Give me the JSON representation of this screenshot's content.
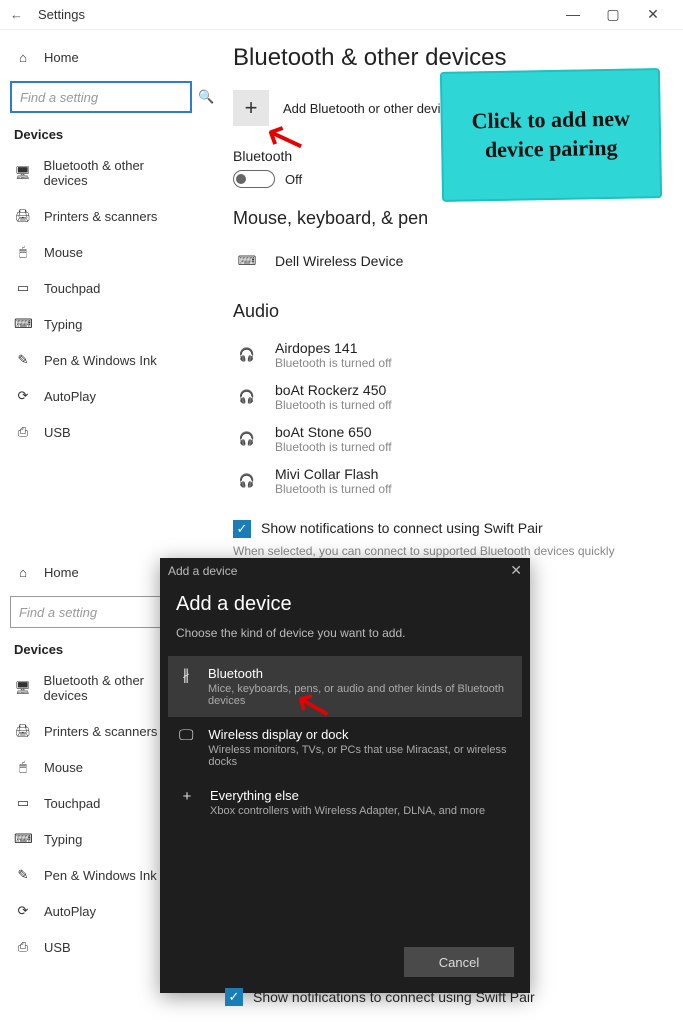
{
  "window": {
    "title": "Settings"
  },
  "nav": {
    "home": "Home",
    "search_placeholder": "Find a setting",
    "section": "Devices",
    "items": [
      {
        "label": "Bluetooth & other devices"
      },
      {
        "label": "Printers & scanners"
      },
      {
        "label": "Mouse"
      },
      {
        "label": "Touchpad"
      },
      {
        "label": "Typing"
      },
      {
        "label": "Pen & Windows Ink"
      },
      {
        "label": "AutoPlay"
      },
      {
        "label": "USB"
      }
    ]
  },
  "page": {
    "title": "Bluetooth & other devices",
    "add_label": "Add Bluetooth or other device",
    "bt_label": "Bluetooth",
    "bt_state": "Off",
    "section_mkb": "Mouse, keyboard, & pen",
    "mkb_device": "Dell Wireless Device",
    "section_audio": "Audio",
    "audio": [
      {
        "name": "Airdopes 141",
        "status": "Bluetooth is turned off"
      },
      {
        "name": "boAt Rockerz 450",
        "status": "Bluetooth is turned off"
      },
      {
        "name": "boAt Stone 650",
        "status": "Bluetooth is turned off"
      },
      {
        "name": "Mivi Collar Flash",
        "status": "Bluetooth is turned off"
      }
    ],
    "swift_label": "Show notifications to connect using Swift Pair",
    "swift_desc": "When selected, you can connect to supported Bluetooth devices quickly when they're close by and in pairing mode."
  },
  "annotation": {
    "text": "Click to add new device pairing"
  },
  "dialog": {
    "head": "Add a device",
    "title": "Add a device",
    "sub": "Choose the kind of device you want to add.",
    "options": [
      {
        "name": "Bluetooth",
        "desc": "Mice, keyboards, pens, or audio and other kinds of Bluetooth devices"
      },
      {
        "name": "Wireless display or dock",
        "desc": "Wireless monitors, TVs, or PCs that use Miracast, or wireless docks"
      },
      {
        "name": "Everything else",
        "desc": "Xbox controllers with Wireless Adapter, DLNA, and more"
      }
    ],
    "cancel": "Cancel"
  },
  "bottom_swift": "Show notifications to connect using Swift Pair"
}
